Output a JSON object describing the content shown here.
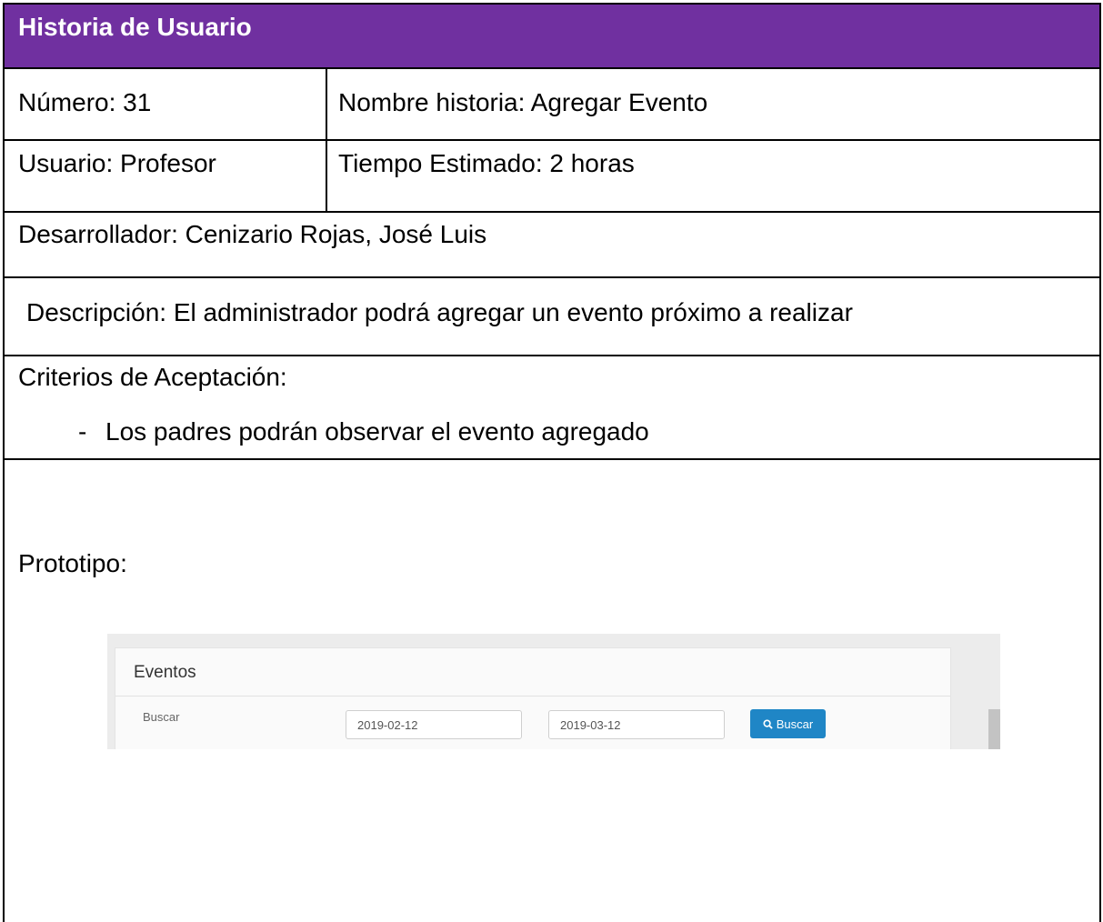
{
  "header": {
    "title": "Historia de Usuario",
    "background": "#7030a0"
  },
  "fields": {
    "numero": "Número: 31",
    "nombre_historia": "Nombre historia: Agregar Evento",
    "usuario": "Usuario: Profesor",
    "tiempo_estimado": "Tiempo Estimado: 2 horas",
    "desarrollador": "Desarrollador: Cenizario Rojas, José Luis",
    "descripcion": "Descripción: El administrador podrá agregar un evento próximo a realizar",
    "criterios_label": "Criterios de Aceptación:",
    "criterios": [
      {
        "bullet": "-",
        "text": "Los padres podrán observar el evento agregado"
      }
    ],
    "prototipo_label": "Prototipo:"
  },
  "prototype": {
    "panel_title": "Eventos",
    "search_label": "Buscar",
    "date_from": "2019-02-12",
    "date_to": "2019-03-12",
    "search_button": {
      "icon": "search-icon",
      "label": "Buscar",
      "color": "#1f86c6"
    }
  }
}
